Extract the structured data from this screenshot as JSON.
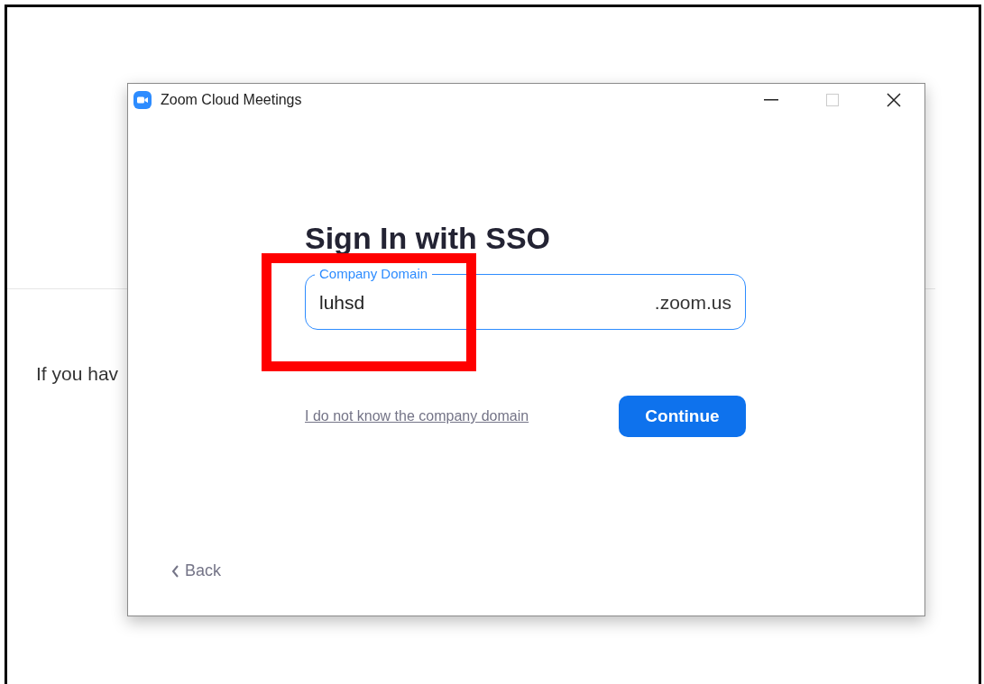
{
  "background_page": {
    "text": "If you hav"
  },
  "window": {
    "title": "Zoom Cloud Meetings",
    "maximize_disabled": true
  },
  "heading": "Sign In with SSO",
  "domain_field": {
    "label": "Company Domain",
    "value": "luhsd",
    "suffix": ".zoom.us",
    "focused": true
  },
  "highlight": {
    "shown": true
  },
  "link": "I do not know the company domain",
  "continue_button": "Continue",
  "back_link": "Back"
}
